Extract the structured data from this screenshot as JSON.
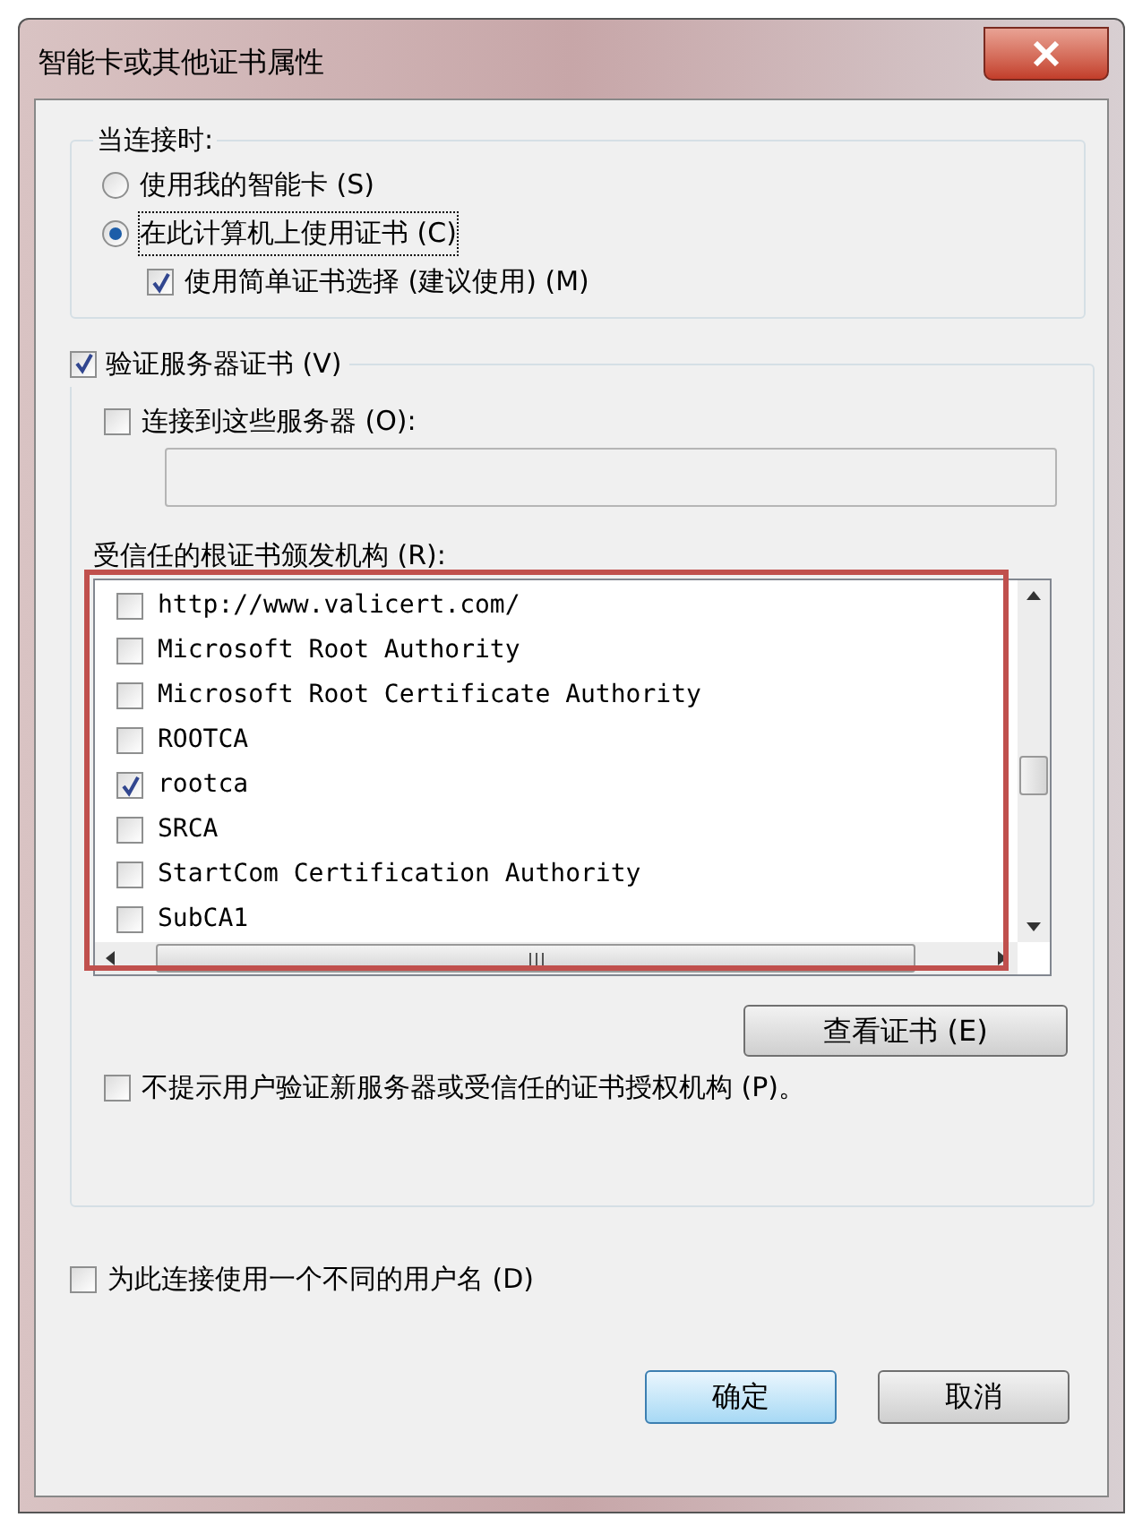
{
  "window": {
    "title": "智能卡或其他证书属性"
  },
  "connect_group": {
    "label": "当连接时:",
    "options": [
      {
        "label": "使用我的智能卡 (S)",
        "selected": false
      },
      {
        "label": "在此计算机上使用证书 (C)",
        "selected": true
      }
    ],
    "simple_selection": {
      "label": "使用简单证书选择 (建议使用) (M)",
      "checked": true
    }
  },
  "verify_group": {
    "label": "验证服务器证书 (V)",
    "checked": true,
    "connect_servers": {
      "label": "连接到这些服务器 (O):",
      "checked": false
    },
    "trusted_label": "受信任的根证书颁发机构 (R):",
    "authorities": [
      {
        "name": "http://www.valicert.com/",
        "checked": false
      },
      {
        "name": "Microsoft Root Authority",
        "checked": false
      },
      {
        "name": "Microsoft Root Certificate Authority",
        "checked": false
      },
      {
        "name": "ROOTCA",
        "checked": false
      },
      {
        "name": "rootca",
        "checked": true
      },
      {
        "name": "SRCA",
        "checked": false
      },
      {
        "name": "StartCom Certification Authority",
        "checked": false
      },
      {
        "name": "SubCA1",
        "checked": false
      }
    ],
    "view_button": "查看证书 (E)",
    "no_prompt": {
      "label": "不提示用户验证新服务器或受信任的证书授权机构 (P)。",
      "checked": false
    }
  },
  "different_user": {
    "label": "为此连接使用一个不同的用户名 (D)",
    "checked": false
  },
  "buttons": [
    {
      "label": "确定",
      "kind": "default"
    },
    {
      "label": "取消",
      "kind": "normal"
    }
  ]
}
